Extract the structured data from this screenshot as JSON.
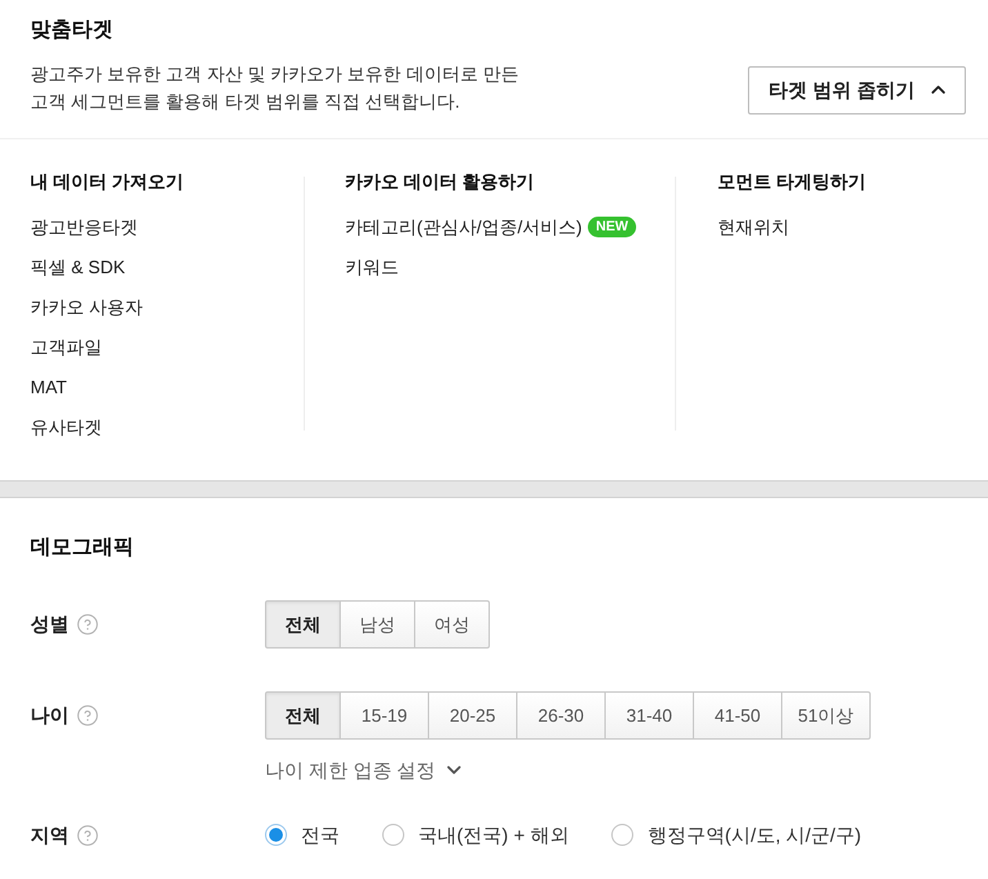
{
  "targeting": {
    "title": "맞춤타겟",
    "description": [
      "광고주가 보유한 고객 자산 및 카카오가 보유한 데이터로 만든",
      "고객 세그먼트를 활용해 타겟 범위를 직접 선택합니다."
    ],
    "toggle_button": {
      "label": "타겟 범위 좁히기",
      "expanded": true
    }
  },
  "target_sources": [
    {
      "title": "내 데이터 가져오기",
      "items": [
        {
          "label": "광고반응타겟"
        },
        {
          "label": "픽셀 & SDK"
        },
        {
          "label": "카카오 사용자"
        },
        {
          "label": "고객파일"
        },
        {
          "label": "MAT"
        },
        {
          "label": "유사타겟"
        }
      ]
    },
    {
      "title": "카카오 데이터 활용하기",
      "items": [
        {
          "label": "카테고리(관심사/업종/서비스)",
          "badge": "NEW"
        },
        {
          "label": "키워드"
        }
      ]
    },
    {
      "title": "모먼트 타게팅하기",
      "items": [
        {
          "label": "현재위치"
        }
      ]
    }
  ],
  "demographic": {
    "title": "데모그래픽",
    "fields": [
      {
        "label": "성별",
        "kind": "segmented",
        "options": [
          {
            "label": "전체",
            "selected": true
          },
          {
            "label": "남성",
            "selected": false
          },
          {
            "label": "여성",
            "selected": false
          }
        ]
      },
      {
        "label": "나이",
        "kind": "segmented",
        "options": [
          {
            "label": "전체",
            "selected": true
          },
          {
            "label": "15-19",
            "selected": false
          },
          {
            "label": "20-25",
            "selected": false
          },
          {
            "label": "26-30",
            "selected": false
          },
          {
            "label": "31-40",
            "selected": false
          },
          {
            "label": "41-50",
            "selected": false
          },
          {
            "label": "51이상",
            "selected": false
          }
        ],
        "more_link": {
          "label": "나이 제한 업종 설정",
          "expanded": false
        }
      },
      {
        "label": "지역",
        "kind": "radio",
        "options": [
          {
            "label": "전국",
            "selected": true
          },
          {
            "label": "국내(전국) + 해외",
            "selected": false
          },
          {
            "label": "행정구역(시/도, 시/군/구)",
            "selected": false
          }
        ]
      }
    ]
  }
}
